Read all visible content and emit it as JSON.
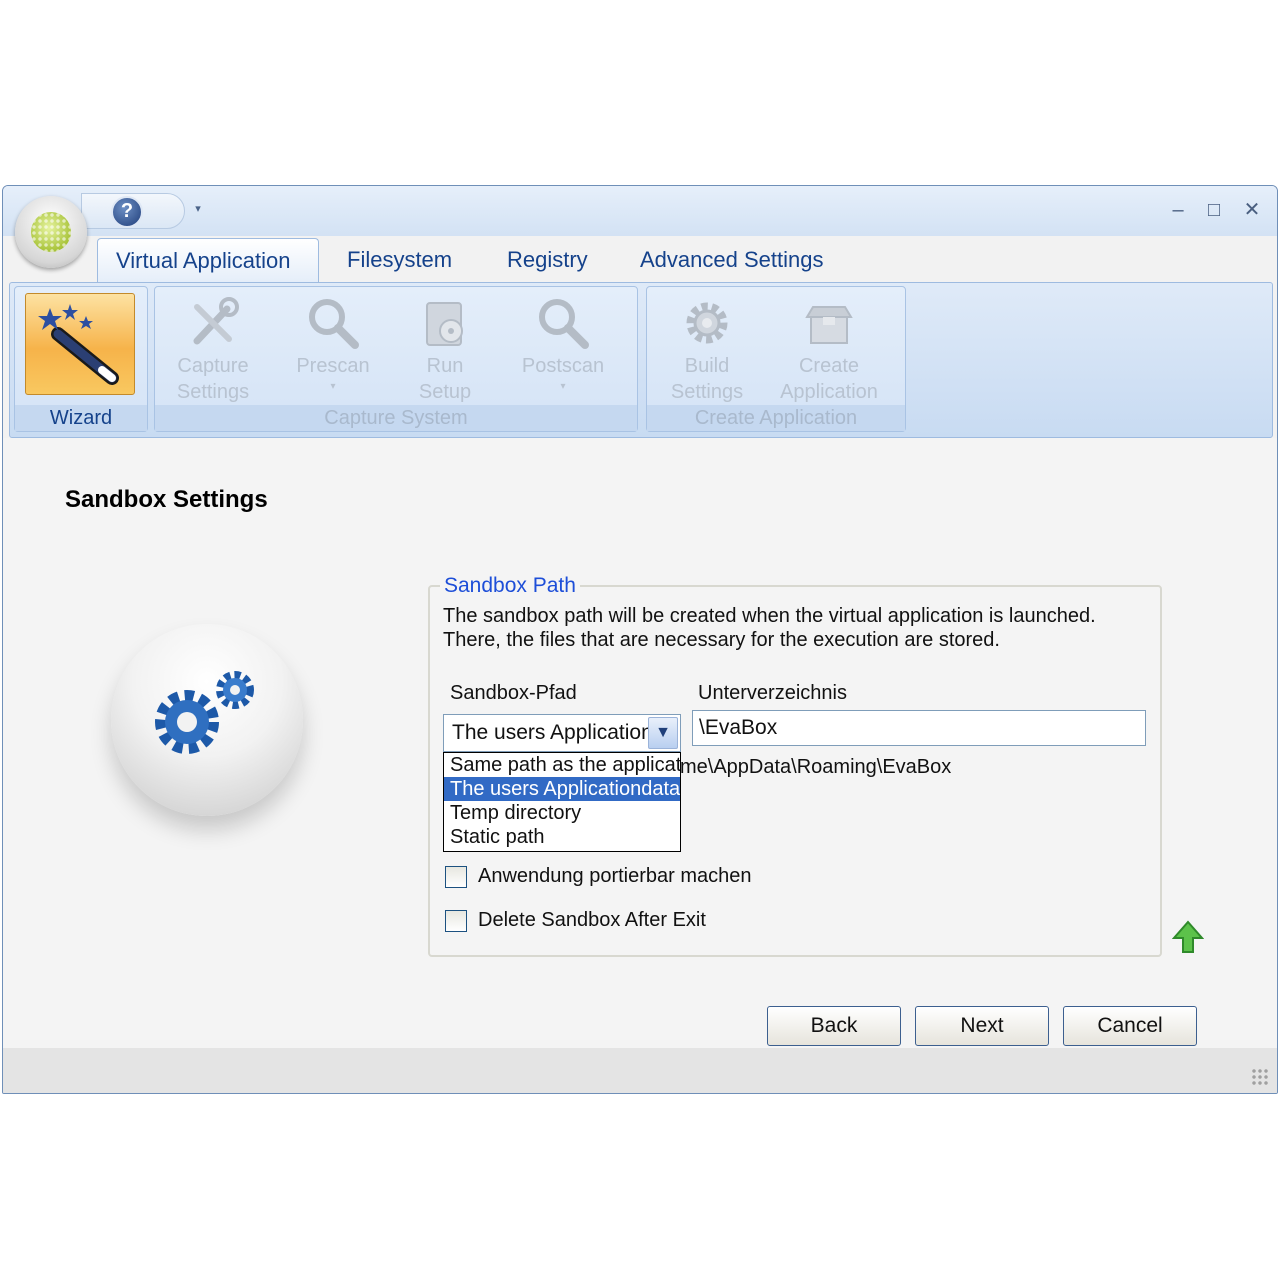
{
  "window": {
    "help_glyph": "?",
    "qat_dropdown": "▾",
    "controls": {
      "minimize": "–",
      "maximize": "□",
      "close": "✕"
    }
  },
  "tabs": [
    {
      "label": "Virtual Application",
      "active": true
    },
    {
      "label": "Filesystem",
      "active": false
    },
    {
      "label": "Registry",
      "active": false
    },
    {
      "label": "Advanced Settings",
      "active": false
    }
  ],
  "ribbon": {
    "wizard": {
      "label": "Wizard"
    },
    "capture_group": {
      "label": "Capture System",
      "buttons": [
        {
          "line1": "Capture",
          "line2": "Settings"
        },
        {
          "line1": "Prescan",
          "line2": "",
          "arrow": "▾"
        },
        {
          "line1": "Run",
          "line2": "Setup"
        },
        {
          "line1": "Postscan",
          "line2": "",
          "arrow": "▾"
        }
      ]
    },
    "create_group": {
      "label": "Create Application",
      "buttons": [
        {
          "line1": "Build",
          "line2": "Settings"
        },
        {
          "line1": "Create",
          "line2": "Application"
        }
      ]
    }
  },
  "content": {
    "title": "Sandbox Settings",
    "group_legend": "Sandbox Path",
    "description": "The sandbox path will be created when the virtual application is launched. There, the files that are necessary for the execution are stored.",
    "sandbox_label": "Sandbox-Pfad",
    "subdir_label": "Unterverzeichnis",
    "combo_value": "The users Applicationdata",
    "subdir_value": "\\EvaBox",
    "path_preview": "me\\AppData\\Roaming\\EvaBox",
    "dropdown_options": [
      "Same path as the application",
      "The users Applicationdata-",
      "Temp directory",
      "Static path"
    ],
    "selected_option_index": 1,
    "checkbox_portable": {
      "label": "Anwendung portierbar machen",
      "checked": false
    },
    "checkbox_delete": {
      "label": "Delete Sandbox After Exit",
      "checked": false
    }
  },
  "buttons": {
    "back": "Back",
    "next": "Next",
    "cancel": "Cancel"
  },
  "colors": {
    "accent": "#15428b",
    "selection": "#316ac5",
    "legend": "#1d4ed8",
    "wizard": "#f6b34a"
  }
}
